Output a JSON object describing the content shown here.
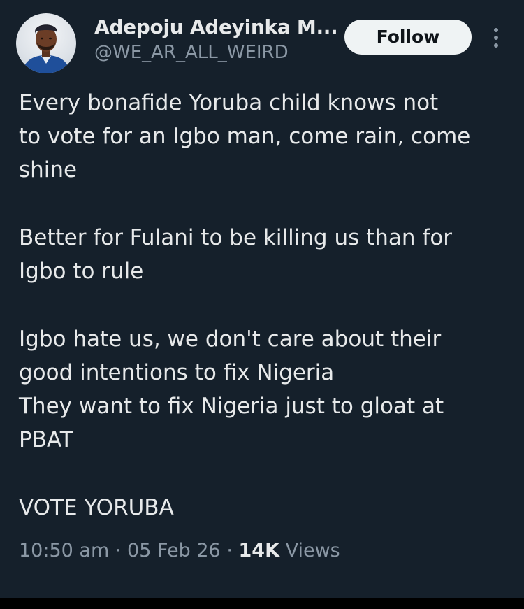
{
  "author": {
    "display_name": "Adepoju Adeyinka M...",
    "handle": "@WE_AR_ALL_WEIRD",
    "avatar_icon": "user-avatar"
  },
  "follow_button": {
    "label": "Follow"
  },
  "more_menu_icon": "vertical-ellipsis-icon",
  "tweet": {
    "paragraphs": [
      {
        "lines": [
          "Every bonafide Yoruba child knows not",
          "to vote for an Igbo man, come rain, come",
          "shine"
        ]
      },
      {
        "lines": [
          "Better for Fulani to be killing us than for",
          "Igbo to rule"
        ]
      },
      {
        "lines": [
          "Igbo hate us, we don't care about their",
          "good intentions to fix Nigeria",
          "They want to fix Nigeria just to gloat at",
          "PBAT"
        ]
      },
      {
        "lines": [
          "VOTE YORUBA"
        ]
      }
    ]
  },
  "meta": {
    "time": "10:50 am",
    "separator": "·",
    "date": "05 Feb 26",
    "views_count": "14K",
    "views_label": "Views"
  },
  "colors": {
    "background": "#15202b",
    "text_primary": "#e7e9ea",
    "text_secondary": "#8b98a5",
    "follow_button_bg": "#eff3f4",
    "follow_button_text": "#0f1419"
  }
}
